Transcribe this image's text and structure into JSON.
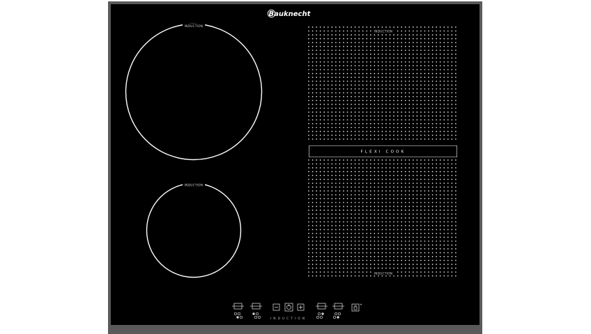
{
  "brand": {
    "name": "Bauknecht"
  },
  "zones": {
    "large_round_label": "INDUCTION",
    "small_round_label": "INDUCTION",
    "flex_top_label": "INDUCTION",
    "flex_bottom_label": "INDUCTION",
    "flex_center_label": "FLEXI  COOK"
  },
  "controls": {
    "bottom_label": "INDUCTION",
    "minus_label": "−",
    "plus_label": "+",
    "power_icon": "power-icon",
    "lock_icon": "lock-icon",
    "zone_selector_icon": "zone-selector-icon"
  },
  "colors": {
    "glass": "#000000",
    "frame": "#5b5b5b",
    "markings": "#ffffff"
  }
}
